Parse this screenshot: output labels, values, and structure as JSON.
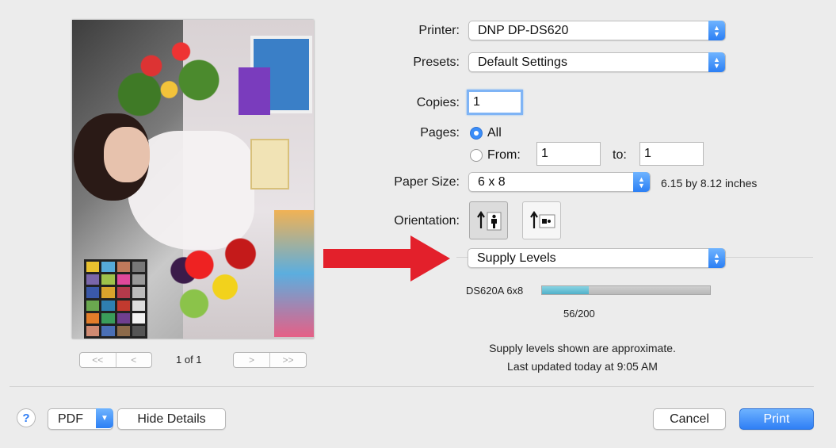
{
  "preview": {
    "page_count": "1 of 1",
    "nav_first": "<<",
    "nav_prev": "<",
    "nav_next": ">",
    "nav_last": ">>"
  },
  "printer": {
    "label": "Printer:",
    "value": "DNP DP-DS620"
  },
  "presets": {
    "label": "Presets:",
    "value": "Default Settings"
  },
  "copies": {
    "label": "Copies:",
    "value": "1"
  },
  "pages": {
    "label": "Pages:",
    "all_label": "All",
    "from_label": "From:",
    "from_value": "1",
    "to_label": "to:",
    "to_value": "1",
    "selected": "All"
  },
  "paper_size": {
    "label": "Paper Size:",
    "value": "6 x 8",
    "dimensions": "6.15 by 8.12 inches"
  },
  "orientation": {
    "label": "Orientation:",
    "selected": "portrait"
  },
  "section": {
    "value": "Supply Levels"
  },
  "supply": {
    "media_label": "DS620A 6x8",
    "count_text": "56/200",
    "remaining": 56,
    "capacity": 200,
    "note_line1": "Supply levels shown are approximate.",
    "note_line2": "Last updated today at 9:05 AM"
  },
  "footer": {
    "help": "?",
    "pdf_label": "PDF",
    "hide_details_label": "Hide Details",
    "cancel_label": "Cancel",
    "print_label": "Print"
  },
  "colors": {
    "accent": "#2f7ff5",
    "annotation_arrow": "#e3202b",
    "supply_fill": "#4fb0c9"
  }
}
